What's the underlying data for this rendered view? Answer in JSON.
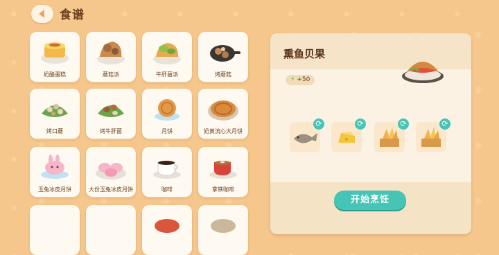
{
  "header": {
    "title": "食谱"
  },
  "recipes": [
    {
      "name": "奶酪蛋糕",
      "icon": "cheesecake-icon"
    },
    {
      "name": "蘑菇派",
      "icon": "mushroom-pie-icon"
    },
    {
      "name": "牛肝菌派",
      "icon": "porcini-pie-icon"
    },
    {
      "name": "烤蘑菇",
      "icon": "roasted-mushroom-icon"
    },
    {
      "name": "烤口蘑",
      "icon": "roasted-button-mushroom-icon"
    },
    {
      "name": "烤牛肝菌",
      "icon": "roasted-porcini-icon"
    },
    {
      "name": "月饼",
      "icon": "mooncake-icon"
    },
    {
      "name": "奶黄流心大月饼",
      "icon": "custard-mooncake-icon"
    },
    {
      "name": "玉兔冰皮月饼",
      "icon": "rabbit-snowskin-mooncake-icon"
    },
    {
      "name": "大份玉兔冰皮月饼",
      "icon": "large-rabbit-mooncake-icon"
    },
    {
      "name": "咖啡",
      "icon": "coffee-icon"
    },
    {
      "name": "拿铁咖啡",
      "icon": "latte-icon"
    }
  ],
  "detail": {
    "title": "熏鱼贝果",
    "energy": "+50",
    "ingredients": [
      {
        "icon": "fish-icon"
      },
      {
        "icon": "cheese-icon"
      },
      {
        "icon": "wheat-crate-icon"
      },
      {
        "icon": "wheat-crate-icon"
      }
    ],
    "cook_label": "开始烹饪"
  }
}
